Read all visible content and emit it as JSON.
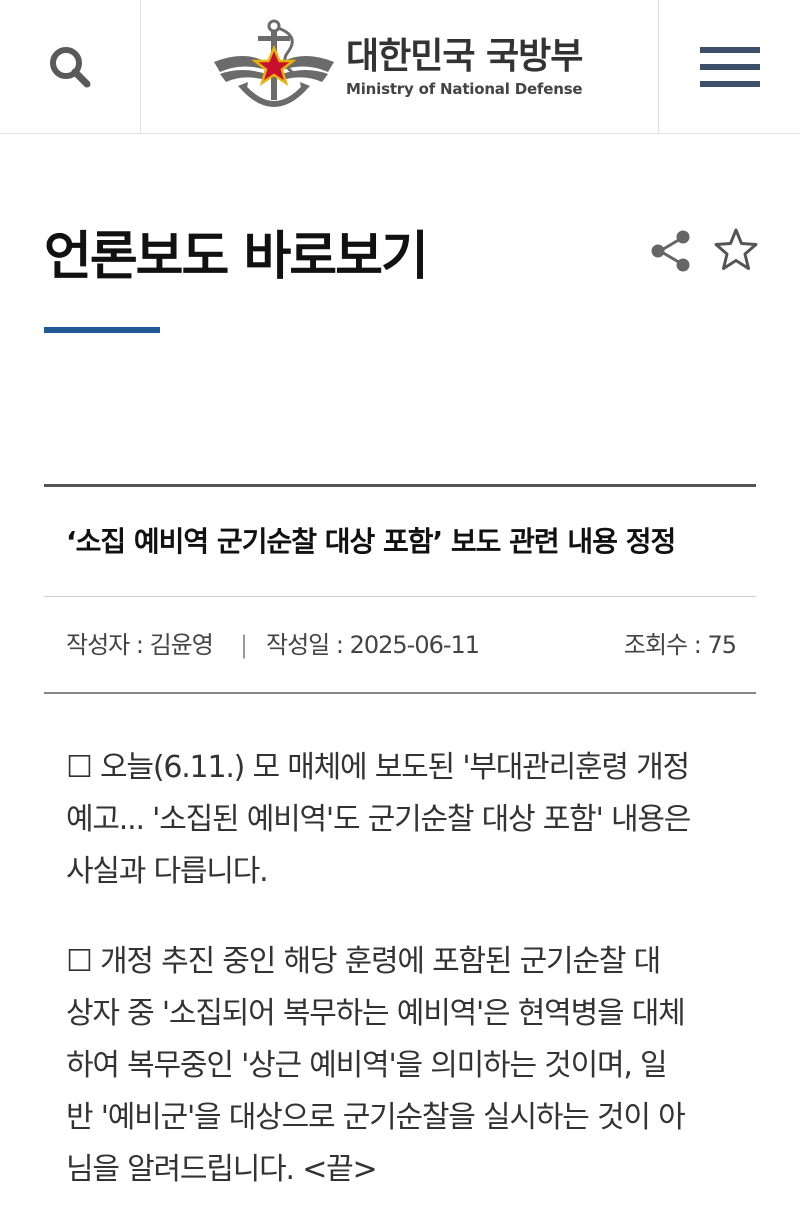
{
  "header": {
    "search_icon": "search-icon",
    "menu_icon": "hamburger-menu-icon",
    "logo_ko": "대한민국 국방부",
    "logo_en": "Ministry of National Defense",
    "brand_colors": {
      "red": "#c8102e",
      "gold": "#e8b20e",
      "gray": "#6b6b6b"
    }
  },
  "page": {
    "title": "언론보도 바로보기",
    "accent": "#1f5a96",
    "share_icon": "share-icon",
    "favorite_icon": "star-icon"
  },
  "article": {
    "title": "‘소집 예비역 군기순찰 대상 포함’ 보도 관련 내용 정정",
    "author": "작성자 : 김윤영",
    "separator": "|",
    "date": "작성일 : 2025-06-11",
    "views": "조회수 : 75",
    "paragraphs": [
      "☐ 오늘(6.11.) 모 매체에 보도된 '부대관리훈령 개정\n예고... '소집된 예비역'도 군기순찰 대상 포함' 내용은\n사실과 다릅니다.",
      "☐ 개정 추진 중인 해당 훈령에 포함된 군기순찰 대\n상자 중 '소집되어 복무하는 예비역'은 현역병을 대체\n하여 복무중인 '상근 예비역'을 의미하는 것이며, 일\n반 '예비군'을 대상으로 군기순찰을 실시하는 것이 아\n님을 알려드립니다. <끝>"
    ]
  }
}
